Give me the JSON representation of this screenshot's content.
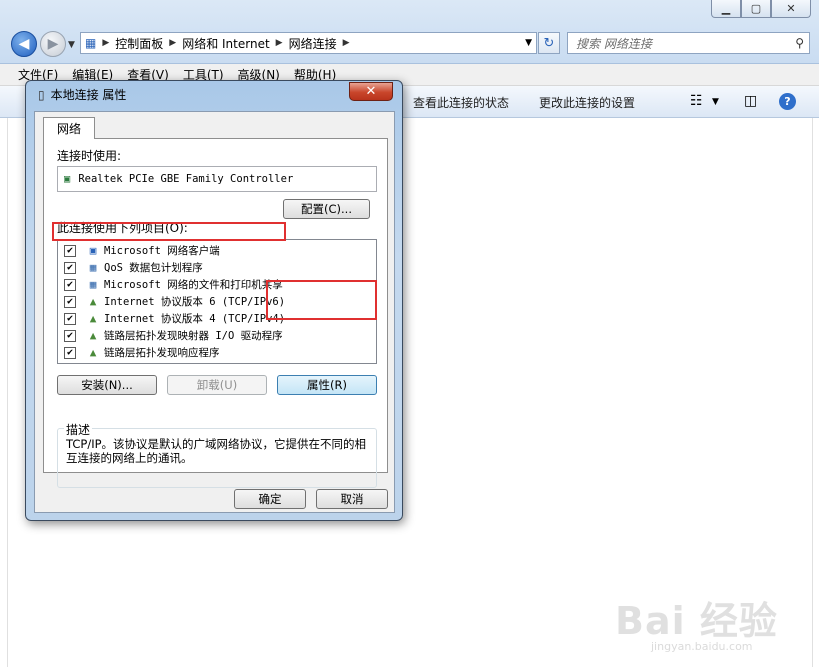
{
  "explorer": {
    "breadcrumb": [
      "控制面板",
      "网络和 Internet",
      "网络连接"
    ],
    "search_placeholder": "搜索 网络连接",
    "menu": [
      "文件(F)",
      "编辑(E)",
      "查看(V)",
      "工具(T)",
      "高级(N)",
      "帮助(H)"
    ],
    "commands": {
      "view_status": "查看此连接的状态",
      "change_settings": "更改此连接的设置"
    }
  },
  "dialog": {
    "title": "本地连接 属性",
    "close_glyph": "✕",
    "tab_label": "网络",
    "connect_using_label": "连接时使用:",
    "adapter_name": "Realtek PCIe GBE Family Controller",
    "configure_button": "配置(C)...",
    "items_label": "此连接使用下列项目(O):",
    "items": [
      {
        "label": "Microsoft 网络客户端",
        "icon": "network-client-icon",
        "checked": true
      },
      {
        "label": "QoS 数据包计划程序",
        "icon": "qos-icon",
        "checked": true
      },
      {
        "label": "Microsoft 网络的文件和打印机共享",
        "icon": "file-share-icon",
        "checked": true
      },
      {
        "label": "Internet 协议版本 6 (TCP/IPv6)",
        "icon": "protocol-icon",
        "checked": true
      },
      {
        "label": "Internet 协议版本 4 (TCP/IPv4)",
        "icon": "protocol-icon",
        "checked": true
      },
      {
        "label": "链路层拓扑发现映射器 I/O 驱动程序",
        "icon": "protocol-icon",
        "checked": true
      },
      {
        "label": "链路层拓扑发现响应程序",
        "icon": "protocol-icon",
        "checked": true
      }
    ],
    "install_button": "安装(N)...",
    "uninstall_button": "卸载(U)",
    "properties_button": "属性(R)",
    "description_label": "描述",
    "description_text": "TCP/IP。该协议是默认的广域网络协议，它提供在不同的相互连接的网络上的通讯。",
    "ok_button": "确定",
    "cancel_button": "取消"
  },
  "watermark": {
    "brand": "Bai 经验",
    "url": "jingyan.baidu.com"
  },
  "colors": {
    "highlight_red": "#e03030",
    "title_blue": "#2f6fcb"
  }
}
